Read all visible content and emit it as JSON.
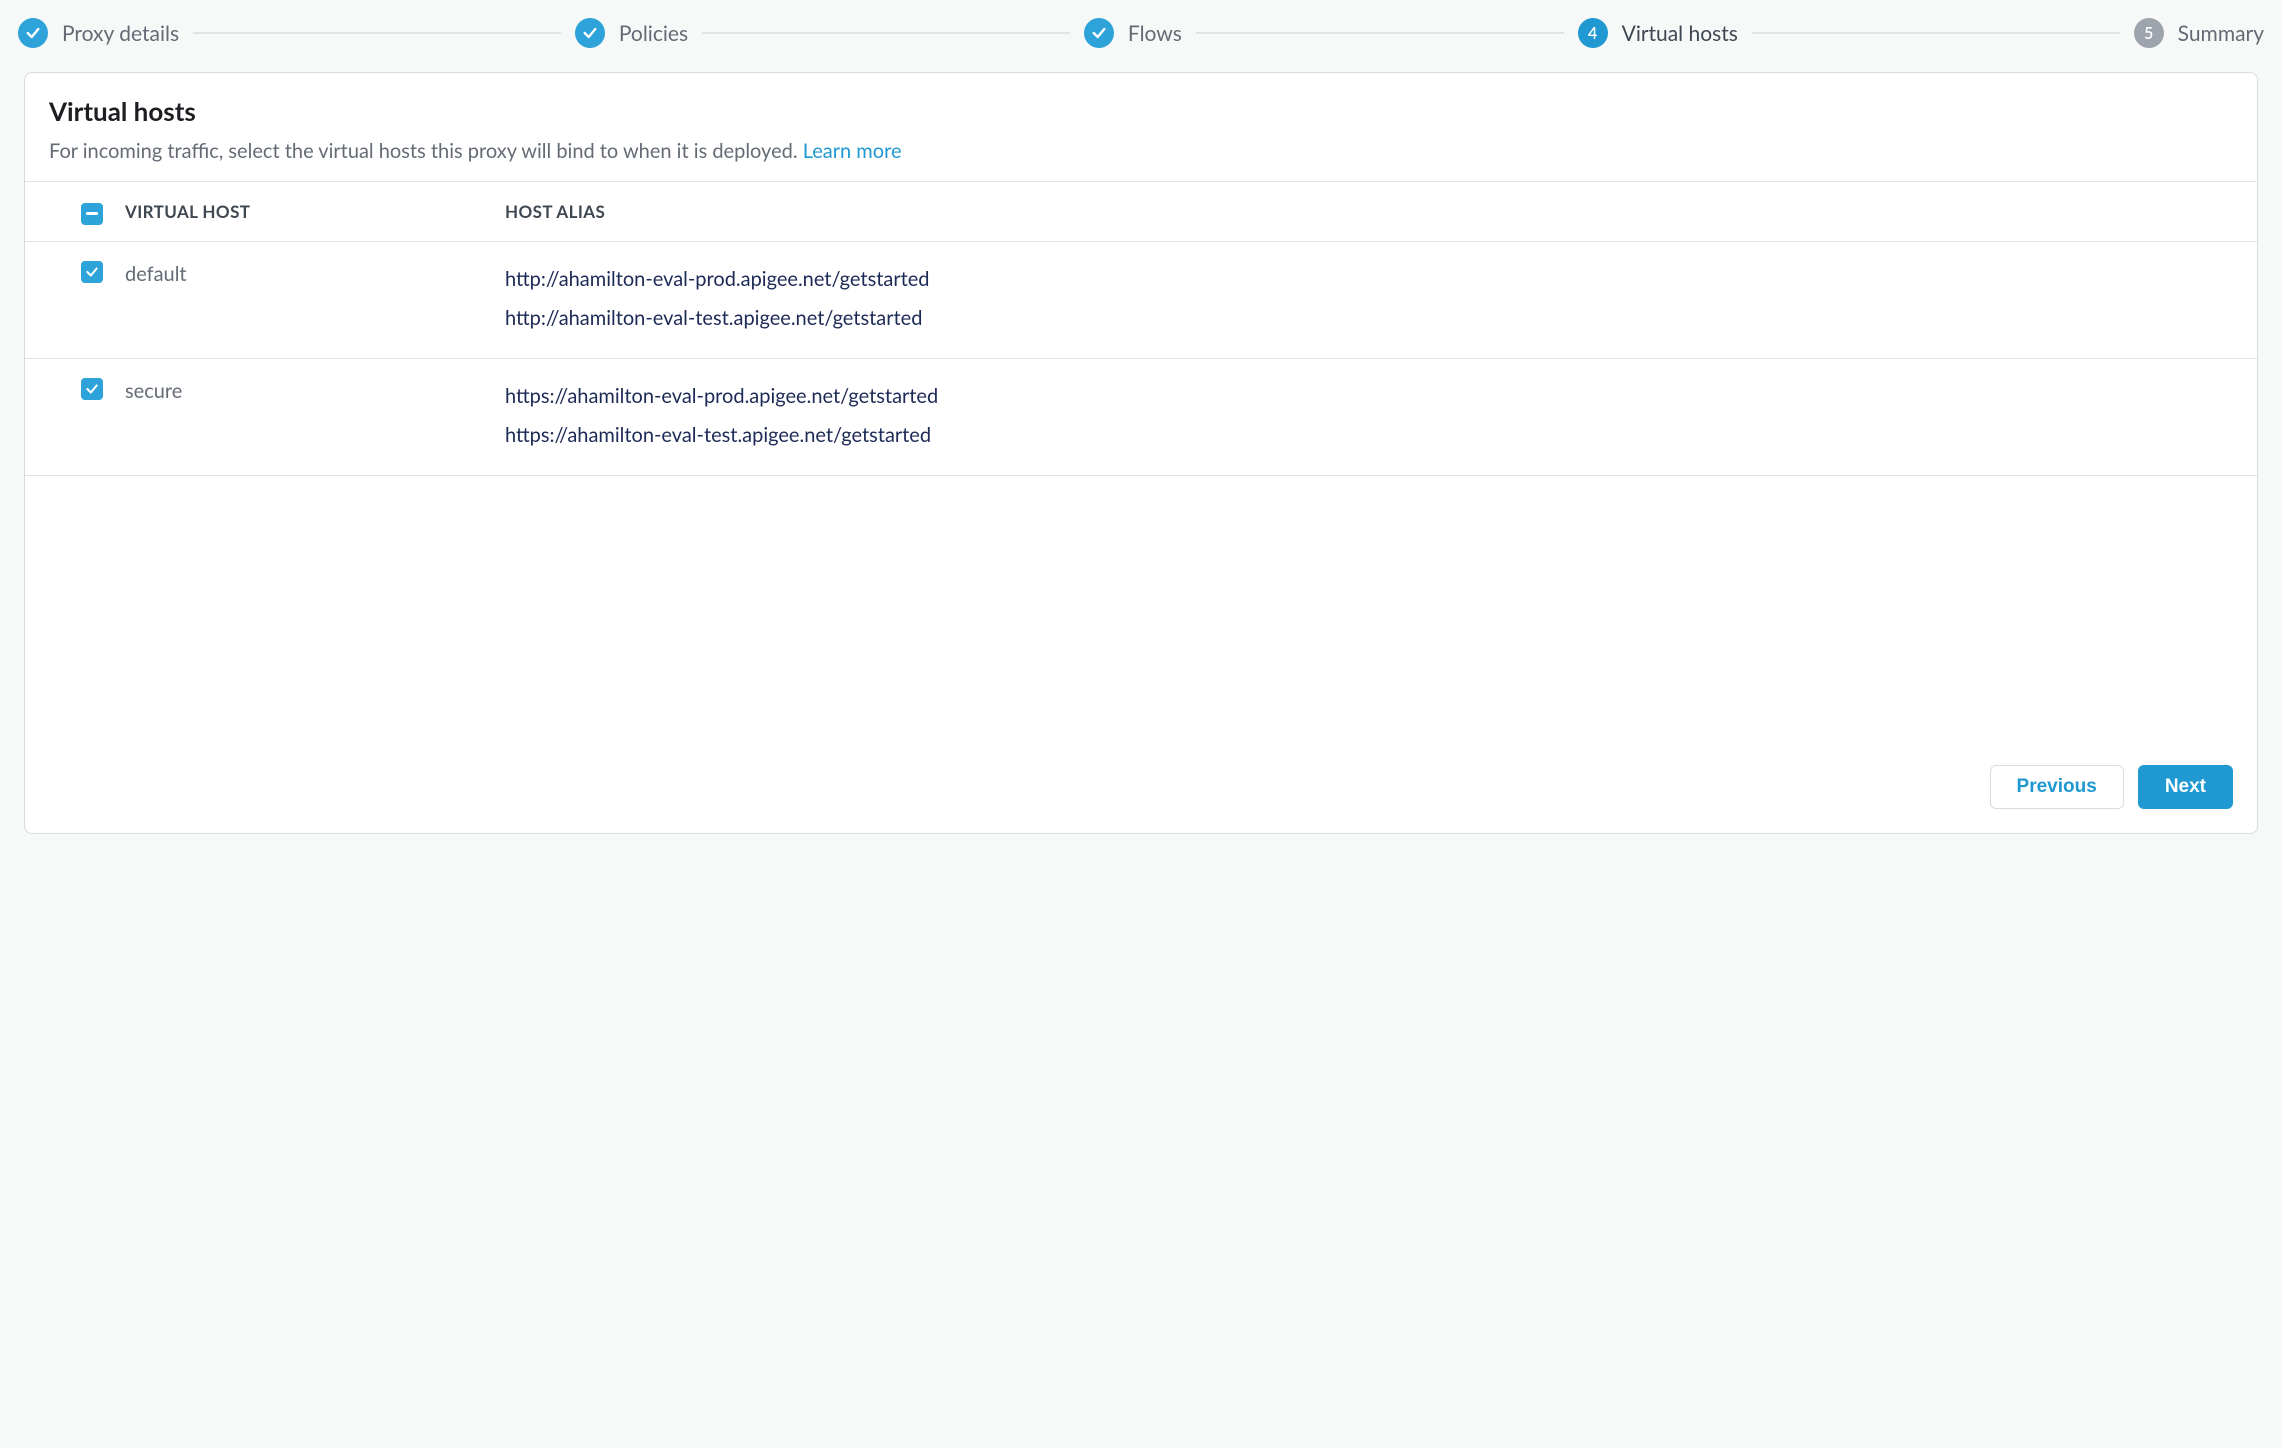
{
  "stepper": {
    "steps": [
      {
        "label": "Proxy details",
        "state": "done"
      },
      {
        "label": "Policies",
        "state": "done"
      },
      {
        "label": "Flows",
        "state": "done"
      },
      {
        "label": "Virtual hosts",
        "state": "current",
        "number": "4"
      },
      {
        "label": "Summary",
        "state": "todo",
        "number": "5"
      }
    ]
  },
  "page": {
    "title": "Virtual hosts",
    "subtitle": "For incoming traffic, select the virtual hosts this proxy will bind to when it is deployed. ",
    "learn_more": "Learn more"
  },
  "table": {
    "col_virtual_host": "VIRTUAL HOST",
    "col_host_alias": "HOST ALIAS",
    "select_all_state": "indeterminate",
    "rows": [
      {
        "name": "default",
        "checked": true,
        "aliases": [
          "http://ahamilton-eval-prod.apigee.net/getstarted",
          "http://ahamilton-eval-test.apigee.net/getstarted"
        ]
      },
      {
        "name": "secure",
        "checked": true,
        "aliases": [
          "https://ahamilton-eval-prod.apigee.net/getstarted",
          "https://ahamilton-eval-test.apigee.net/getstarted"
        ]
      }
    ]
  },
  "footer": {
    "previous": "Previous",
    "next": "Next"
  }
}
